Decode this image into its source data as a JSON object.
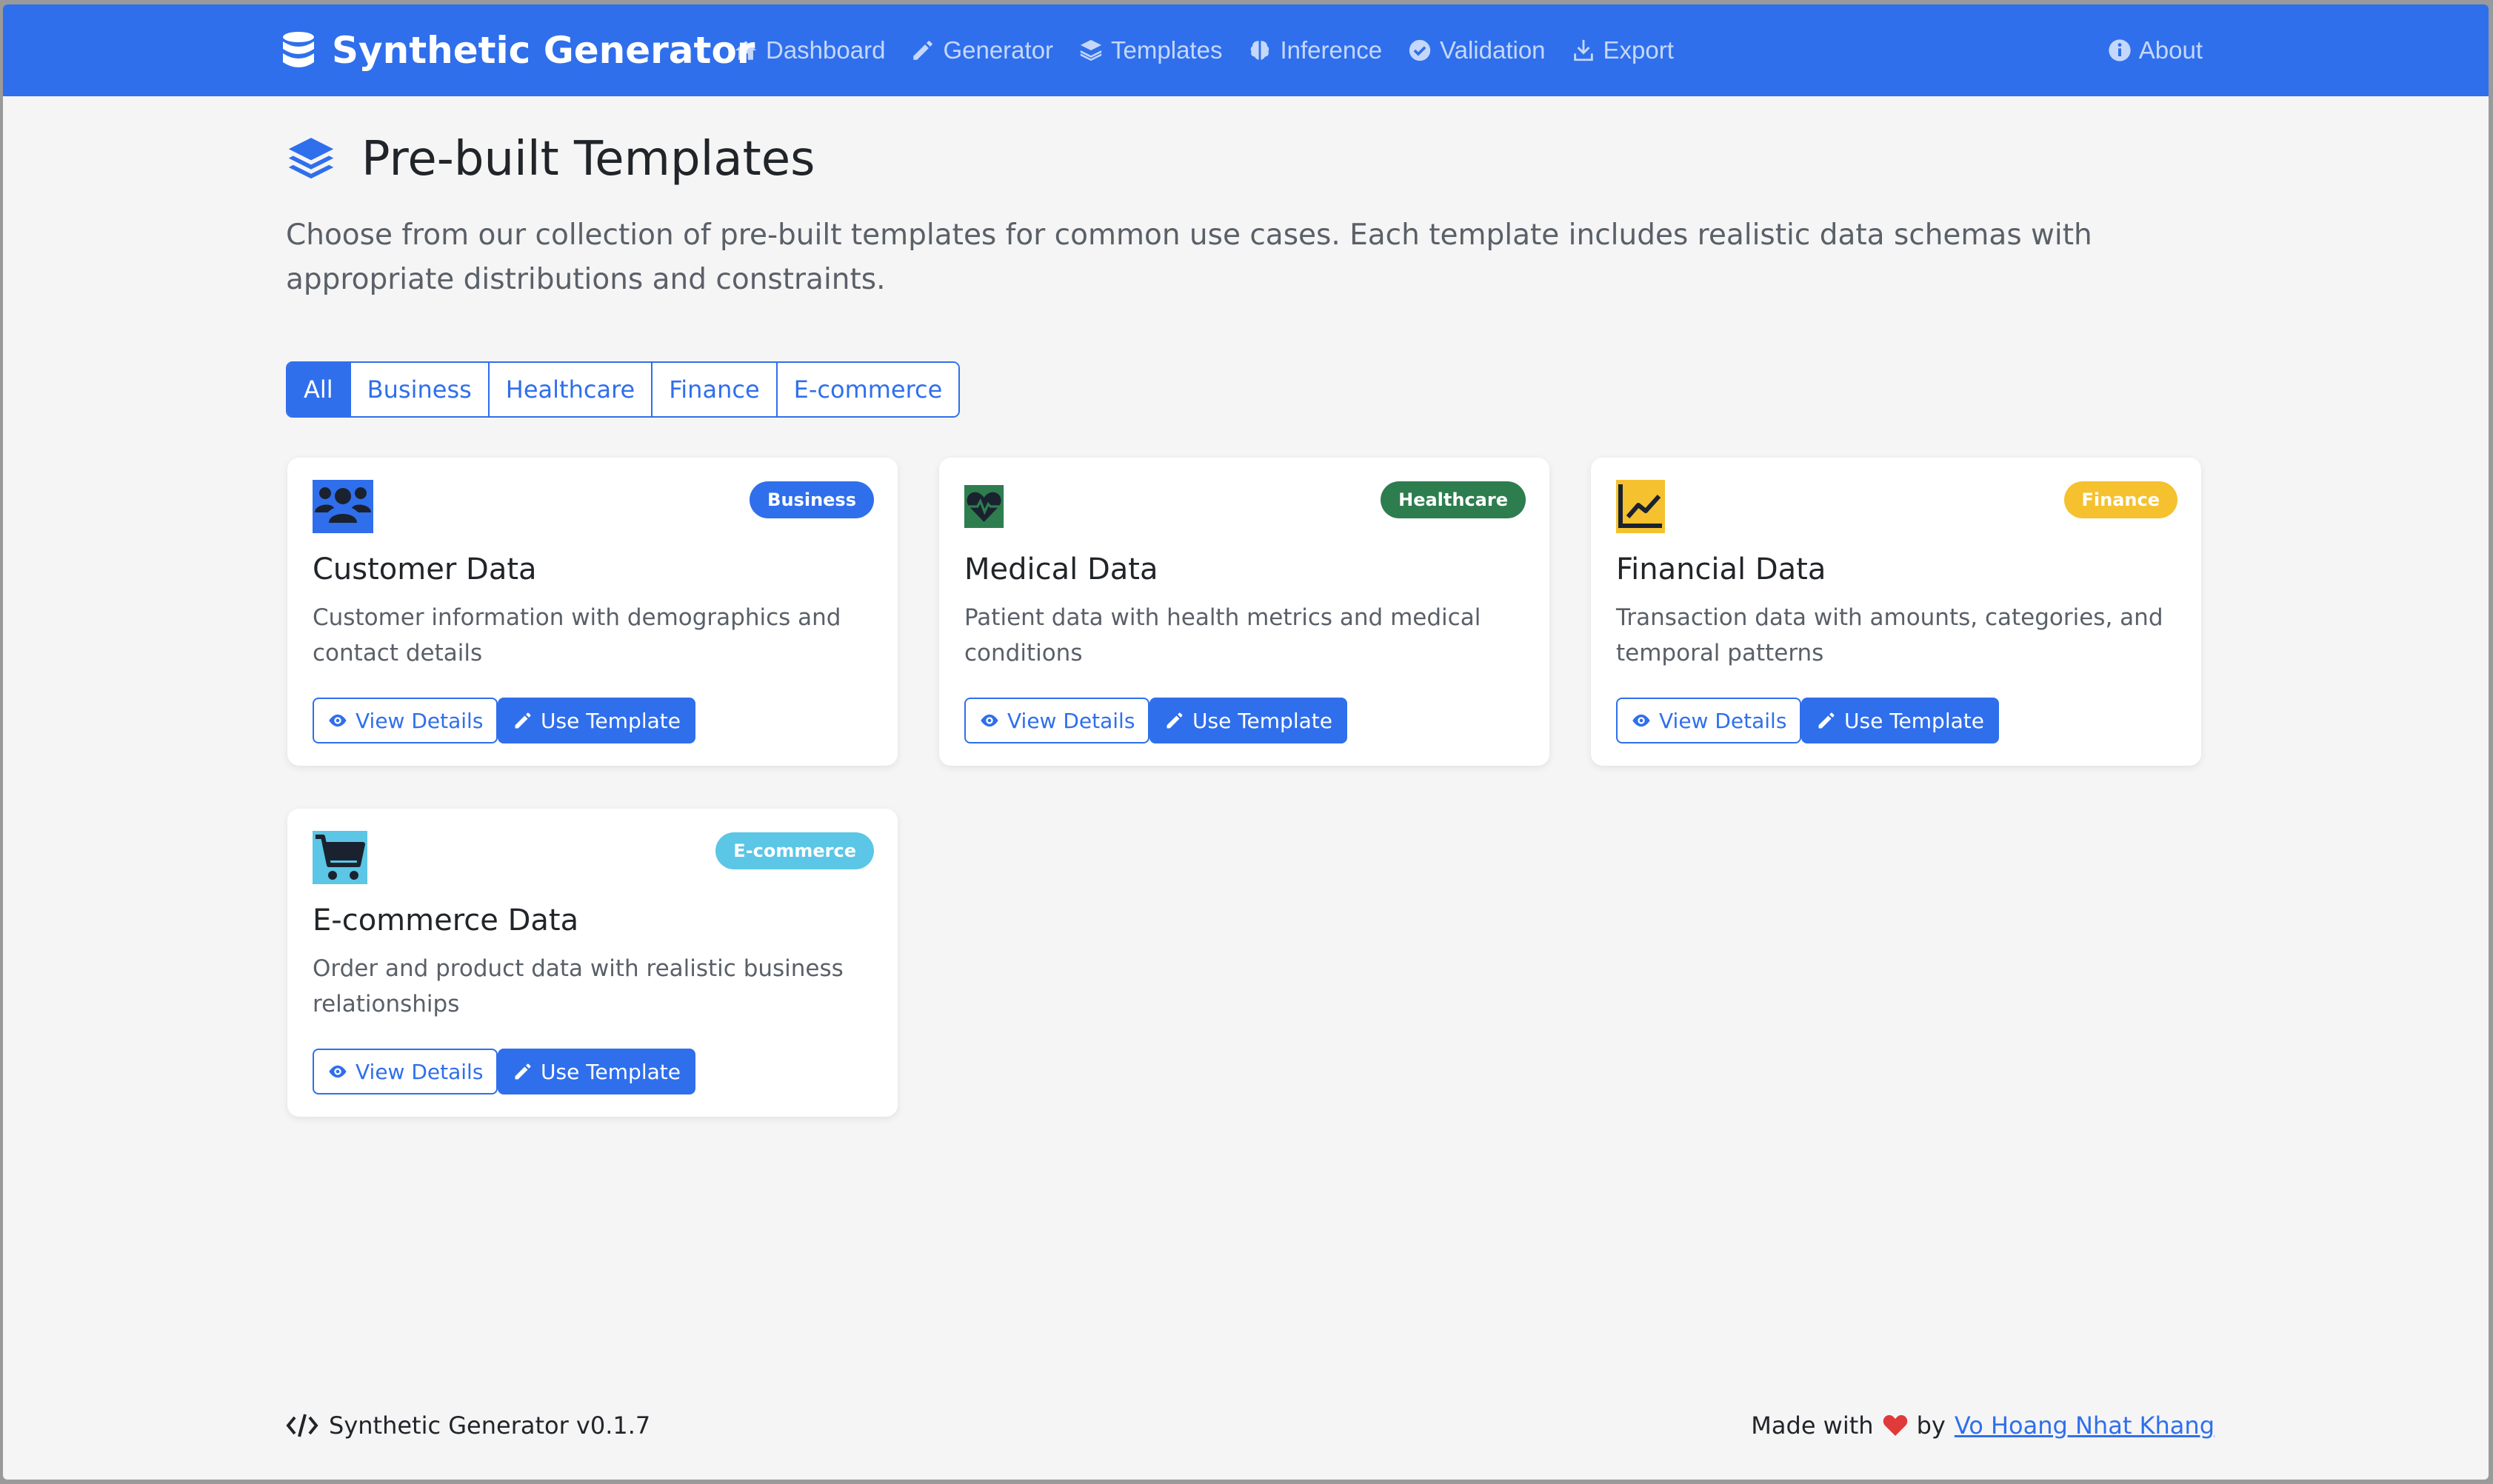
{
  "navbar": {
    "brand": "Synthetic Generator",
    "links": [
      {
        "label": "Dashboard",
        "icon": "house-icon"
      },
      {
        "label": "Generator",
        "icon": "pencil-icon"
      },
      {
        "label": "Templates",
        "icon": "layers-icon"
      },
      {
        "label": "Inference",
        "icon": "brain-icon"
      },
      {
        "label": "Validation",
        "icon": "check-circle-icon"
      },
      {
        "label": "Export",
        "icon": "download-icon"
      }
    ],
    "about": "About"
  },
  "page": {
    "title": "Pre-built Templates",
    "description": "Choose from our collection of pre-built templates for common use cases. Each template includes realistic data schemas with appropriate distributions and constraints."
  },
  "filters": {
    "options": [
      "All",
      "Business",
      "Healthcare",
      "Finance",
      "E-commerce"
    ],
    "selected": "All"
  },
  "templates": [
    {
      "title": "Customer Data",
      "badge": "Business",
      "badge_color": "#2f6fec",
      "icon": "users-icon",
      "description": "Customer information with demographics and contact details"
    },
    {
      "title": "Medical Data",
      "badge": "Healthcare",
      "badge_color": "#2e7d4f",
      "icon": "heart-pulse-icon",
      "description": "Patient data with health metrics and medical conditions"
    },
    {
      "title": "Financial Data",
      "badge": "Finance",
      "badge_color": "#f5c12e",
      "icon": "chart-line-icon",
      "description": "Transaction data with amounts, categories, and temporal patterns"
    },
    {
      "title": "E-commerce Data",
      "badge": "E-commerce",
      "badge_color": "#5bc6e6",
      "icon": "cart-icon",
      "description": "Order and product data with realistic business relationships"
    }
  ],
  "buttons": {
    "view": "View Details",
    "use": "Use Template"
  },
  "footer": {
    "version": "Synthetic Generator v0.1.7",
    "made_with": "Made with",
    "by": "by",
    "author": "Vo Hoang Nhat Khang"
  },
  "colors": {
    "primary": "#2f6fec",
    "background": "#f5f5f6",
    "heart": "#e03a3a"
  }
}
